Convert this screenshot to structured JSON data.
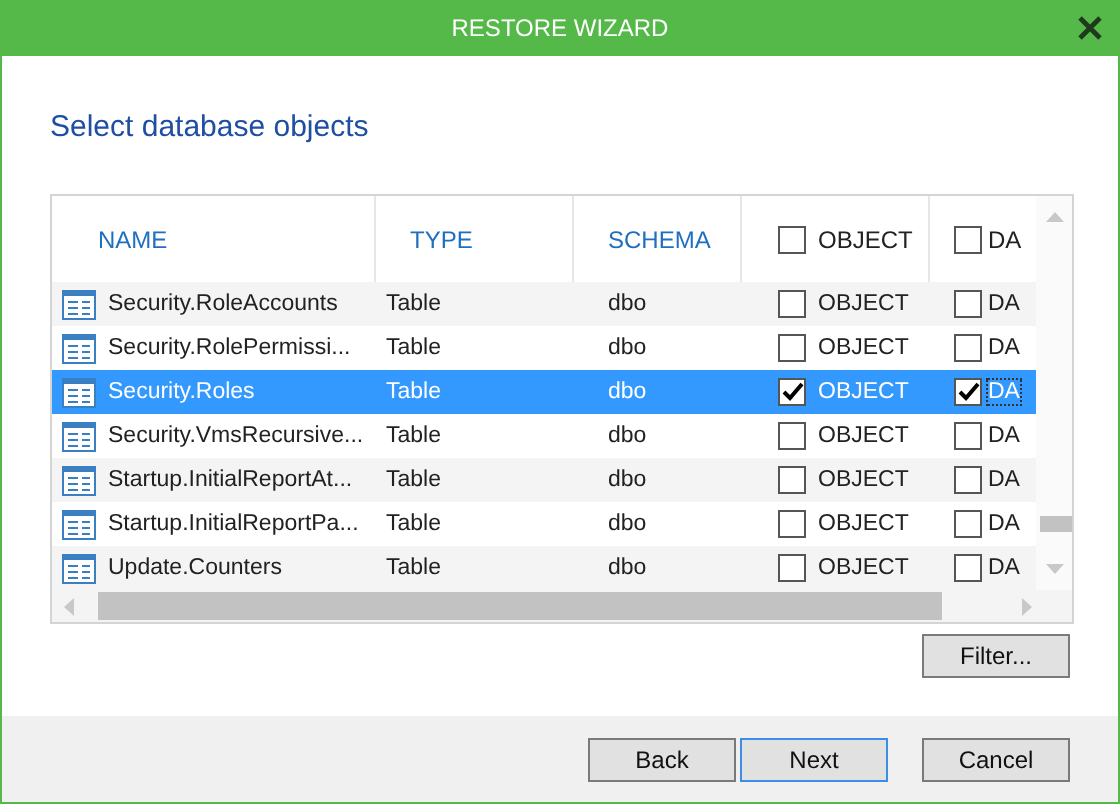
{
  "window": {
    "title": "RESTORE WIZARD"
  },
  "heading": "Select database objects",
  "table": {
    "columns": [
      {
        "label": "NAME",
        "kind": "text"
      },
      {
        "label": "TYPE",
        "kind": "text"
      },
      {
        "label": "SCHEMA",
        "kind": "text"
      },
      {
        "label": "OBJECT",
        "kind": "check",
        "checked": false
      },
      {
        "label": "DA",
        "kind": "check",
        "checked": false
      }
    ],
    "rows": [
      {
        "name": "Security.RoleAccounts",
        "type": "Table",
        "schema": "dbo",
        "object": {
          "label": "OBJECT",
          "checked": false
        },
        "data": {
          "label": "DA",
          "checked": false
        },
        "selected": false
      },
      {
        "name": "Security.RolePermissi...",
        "type": "Table",
        "schema": "dbo",
        "object": {
          "label": "OBJECT",
          "checked": false
        },
        "data": {
          "label": "DA",
          "checked": false
        },
        "selected": false
      },
      {
        "name": "Security.Roles",
        "type": "Table",
        "schema": "dbo",
        "object": {
          "label": "OBJECT",
          "checked": true
        },
        "data": {
          "label": "DA",
          "checked": true
        },
        "selected": true
      },
      {
        "name": "Security.VmsRecursive...",
        "type": "Table",
        "schema": "dbo",
        "object": {
          "label": "OBJECT",
          "checked": false
        },
        "data": {
          "label": "DA",
          "checked": false
        },
        "selected": false
      },
      {
        "name": "Startup.InitialReportAt...",
        "type": "Table",
        "schema": "dbo",
        "object": {
          "label": "OBJECT",
          "checked": false
        },
        "data": {
          "label": "DA",
          "checked": false
        },
        "selected": false
      },
      {
        "name": "Startup.InitialReportPa...",
        "type": "Table",
        "schema": "dbo",
        "object": {
          "label": "OBJECT",
          "checked": false
        },
        "data": {
          "label": "DA",
          "checked": false
        },
        "selected": false
      },
      {
        "name": "Update.Counters",
        "type": "Table",
        "schema": "dbo",
        "object": {
          "label": "OBJECT",
          "checked": false
        },
        "data": {
          "label": "DA",
          "checked": false
        },
        "selected": false
      }
    ]
  },
  "filter_button": "Filter...",
  "buttons": [
    {
      "label": "Back",
      "selected": false
    },
    {
      "label": "Next",
      "selected": true
    },
    {
      "label": "Cancel",
      "selected": false
    }
  ]
}
